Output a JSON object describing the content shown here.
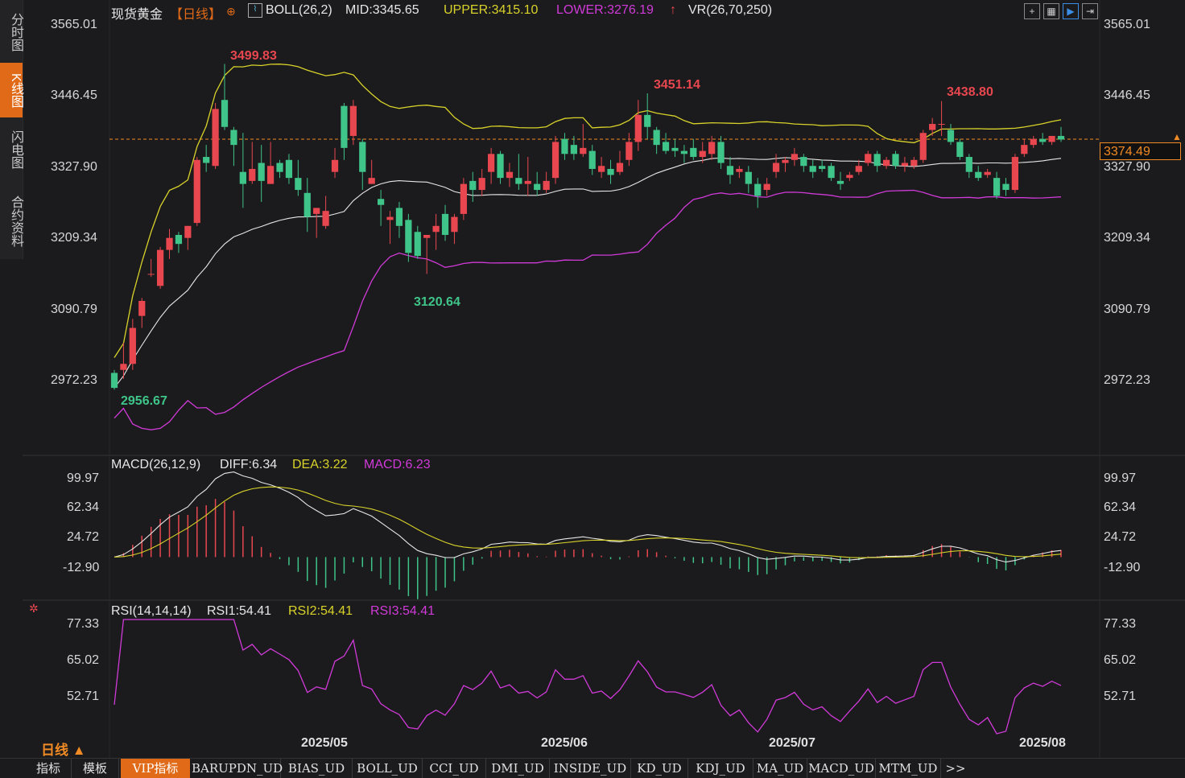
{
  "sidebar": {
    "items": [
      {
        "label": "分时图",
        "active": false
      },
      {
        "label": "K线图",
        "active": true
      },
      {
        "label": "闪电图",
        "active": false
      },
      {
        "label": "合约资料",
        "active": false
      }
    ]
  },
  "header": {
    "symbol": "现货黄金",
    "period_tag": "【日线】",
    "boll_label": "BOLL(26,2)",
    "mid": "MID:3345.65",
    "upper": "UPPER:3415.10",
    "lower": "LOWER:3276.19",
    "vr": "VR(26,70,250)"
  },
  "price_axis": {
    "ticks": [
      "3565.01",
      "3446.45",
      "3327.90",
      "3209.34",
      "3090.79",
      "2972.23"
    ],
    "current_price": "3374.49"
  },
  "annotations": {
    "high1": "3499.83",
    "high2": "3451.14",
    "high3": "3438.80",
    "low1": "2956.67",
    "low2": "3120.64"
  },
  "macd": {
    "title": "MACD(26,12,9)",
    "diff": "DIFF:6.34",
    "dea": "DEA:3.22",
    "macd": "MACD:6.23",
    "ticks": [
      "99.97",
      "62.34",
      "24.72",
      "-12.90"
    ]
  },
  "rsi": {
    "title": "RSI(14,14,14)",
    "rsi1": "RSI1:54.41",
    "rsi2": "RSI2:54.41",
    "rsi3": "RSI3:54.41",
    "ticks": [
      "77.33",
      "65.02",
      "52.71"
    ]
  },
  "x_axis": {
    "labels": [
      "2025/05",
      "2025/06",
      "2025/07",
      "2025/08"
    ]
  },
  "period_selector": "日线 ▲",
  "tabs": [
    "指标",
    "模板",
    "VIP指标",
    "BARUPDN_UD",
    "BIAS_UD",
    "BOLL_UD",
    "CCI_UD",
    "DMI_UD",
    "INSIDE_UD",
    "KD_UD",
    "KDJ_UD",
    "MA_UD",
    "MACD_UD",
    "MTM_UD",
    ">>"
  ],
  "colors": {
    "up": "#e8474f",
    "down": "#3fc489",
    "mid": "#e6e6e6",
    "upper": "#d8d22a",
    "lower": "#d03ad8",
    "accent": "#e06a17"
  },
  "chart_data": {
    "type": "candlestick",
    "title": "现货黄金【日线】",
    "ylim": [
      2900,
      3600
    ],
    "candles": [
      [
        2985,
        2990,
        2960,
        2957
      ],
      [
        2990,
        3035,
        3000,
        2975
      ],
      [
        3000,
        3075,
        3060,
        2990
      ],
      [
        3080,
        3110,
        3105,
        3060
      ],
      [
        3150,
        3175,
        3150,
        3145
      ],
      [
        3130,
        3195,
        3190,
        3125
      ],
      [
        3190,
        3225,
        3210,
        3175
      ],
      [
        3215,
        3220,
        3200,
        3185
      ],
      [
        3210,
        3230,
        3230,
        3190
      ],
      [
        3235,
        3345,
        3340,
        3230
      ],
      [
        3345,
        3365,
        3335,
        3320
      ],
      [
        3330,
        3435,
        3425,
        3325
      ],
      [
        3440,
        3500,
        3395,
        3390
      ],
      [
        3390,
        3395,
        3365,
        3330
      ],
      [
        3320,
        3385,
        3300,
        3260
      ],
      [
        3305,
        3370,
        3325,
        3300
      ],
      [
        3335,
        3365,
        3305,
        3270
      ],
      [
        3300,
        3370,
        3330,
        3300
      ],
      [
        3335,
        3340,
        3320,
        3310
      ],
      [
        3340,
        3350,
        3310,
        3300
      ],
      [
        3310,
        3340,
        3290,
        3280
      ],
      [
        3285,
        3310,
        3245,
        3220
      ],
      [
        3250,
        3260,
        3260,
        3210
      ],
      [
        3230,
        3280,
        3255,
        3225
      ],
      [
        3320,
        3360,
        3340,
        3310
      ],
      [
        3430,
        3435,
        3360,
        3340
      ],
      [
        3380,
        3440,
        3430,
        3365
      ],
      [
        3370,
        3375,
        3320,
        3290
      ],
      [
        3300,
        3340,
        3310,
        3300
      ],
      [
        3275,
        3290,
        3265,
        3230
      ],
      [
        3240,
        3255,
        3245,
        3200
      ],
      [
        3260,
        3270,
        3230,
        3210
      ],
      [
        3240,
        3250,
        3185,
        3170
      ],
      [
        3220,
        3230,
        3180,
        3175
      ],
      [
        3210,
        3215,
        3215,
        3150
      ],
      [
        3220,
        3250,
        3230,
        3190
      ],
      [
        3250,
        3265,
        3215,
        3205
      ],
      [
        3220,
        3250,
        3245,
        3200
      ],
      [
        3250,
        3310,
        3300,
        3240
      ],
      [
        3305,
        3320,
        3290,
        3270
      ],
      [
        3290,
        3325,
        3310,
        3280
      ],
      [
        3320,
        3360,
        3350,
        3300
      ],
      [
        3350,
        3355,
        3310,
        3300
      ],
      [
        3310,
        3335,
        3320,
        3295
      ],
      [
        3310,
        3350,
        3300,
        3290
      ],
      [
        3300,
        3345,
        3305,
        3280
      ],
      [
        3300,
        3320,
        3290,
        3280
      ],
      [
        3290,
        3320,
        3305,
        3285
      ],
      [
        3310,
        3380,
        3370,
        3300
      ],
      [
        3375,
        3385,
        3350,
        3340
      ],
      [
        3365,
        3380,
        3350,
        3340
      ],
      [
        3350,
        3400,
        3360,
        3345
      ],
      [
        3355,
        3365,
        3325,
        3315
      ],
      [
        3320,
        3345,
        3330,
        3310
      ],
      [
        3325,
        3340,
        3315,
        3300
      ],
      [
        3320,
        3355,
        3335,
        3315
      ],
      [
        3340,
        3385,
        3370,
        3330
      ],
      [
        3370,
        3440,
        3415,
        3355
      ],
      [
        3415,
        3451,
        3395,
        3375
      ],
      [
        3390,
        3395,
        3365,
        3350
      ],
      [
        3370,
        3385,
        3355,
        3350
      ],
      [
        3360,
        3375,
        3355,
        3345
      ],
      [
        3355,
        3365,
        3350,
        3335
      ],
      [
        3360,
        3375,
        3345,
        3340
      ],
      [
        3345,
        3370,
        3355,
        3335
      ],
      [
        3350,
        3380,
        3370,
        3340
      ],
      [
        3370,
        3380,
        3335,
        3325
      ],
      [
        3330,
        3345,
        3315,
        3300
      ],
      [
        3320,
        3330,
        3325,
        3310
      ],
      [
        3320,
        3330,
        3300,
        3285
      ],
      [
        3300,
        3310,
        3280,
        3260
      ],
      [
        3290,
        3310,
        3300,
        3280
      ],
      [
        3320,
        3350,
        3335,
        3310
      ],
      [
        3335,
        3345,
        3340,
        3320
      ],
      [
        3340,
        3360,
        3350,
        3330
      ],
      [
        3345,
        3350,
        3330,
        3320
      ],
      [
        3330,
        3340,
        3320,
        3310
      ],
      [
        3330,
        3340,
        3325,
        3320
      ],
      [
        3330,
        3335,
        3310,
        3305
      ],
      [
        3305,
        3320,
        3300,
        3290
      ],
      [
        3310,
        3320,
        3315,
        3305
      ],
      [
        3320,
        3340,
        3330,
        3315
      ],
      [
        3335,
        3355,
        3350,
        3330
      ],
      [
        3350,
        3355,
        3330,
        3320
      ],
      [
        3330,
        3345,
        3340,
        3325
      ],
      [
        3350,
        3355,
        3330,
        3325
      ],
      [
        3330,
        3345,
        3335,
        3320
      ],
      [
        3330,
        3345,
        3340,
        3325
      ],
      [
        3340,
        3390,
        3385,
        3335
      ],
      [
        3390,
        3410,
        3400,
        3380
      ],
      [
        3400,
        3438,
        3400,
        3380
      ],
      [
        3390,
        3400,
        3370,
        3365
      ],
      [
        3370,
        3375,
        3345,
        3340
      ],
      [
        3345,
        3350,
        3320,
        3310
      ],
      [
        3320,
        3330,
        3310,
        3305
      ],
      [
        3315,
        3325,
        3320,
        3310
      ],
      [
        3310,
        3320,
        3280,
        3275
      ],
      [
        3300,
        3310,
        3290,
        3280
      ],
      [
        3290,
        3350,
        3345,
        3285
      ],
      [
        3350,
        3375,
        3365,
        3345
      ],
      [
        3365,
        3380,
        3375,
        3360
      ],
      [
        3375,
        3385,
        3370,
        3365
      ],
      [
        3370,
        3380,
        3380,
        3365
      ],
      [
        3380,
        3395,
        3374,
        3370
      ]
    ]
  }
}
